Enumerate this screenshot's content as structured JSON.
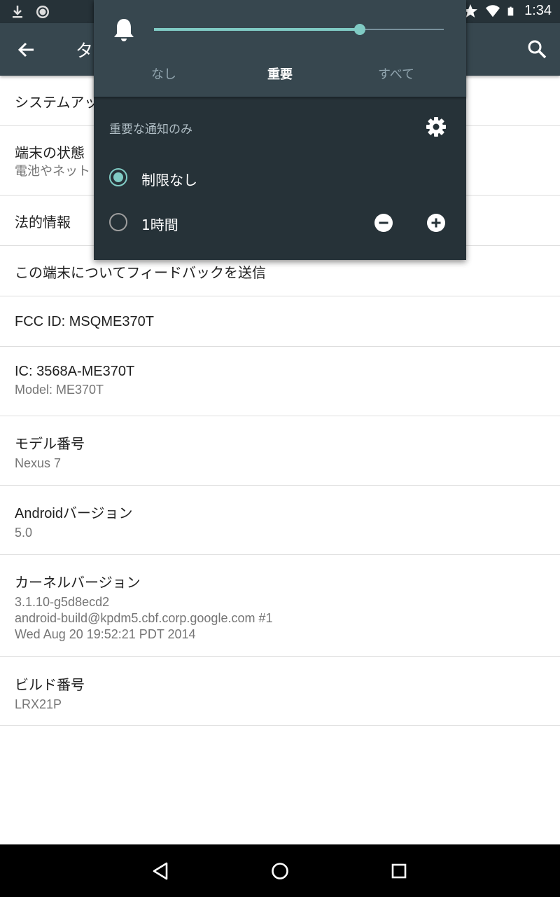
{
  "status_bar": {
    "time": "1:34",
    "left_icons": [
      "download-icon",
      "sync-icon"
    ],
    "right_icons": [
      "star-icon",
      "wifi-icon",
      "battery-icon"
    ]
  },
  "toolbar": {
    "title": "タ",
    "back_icon": "back-arrow-icon",
    "search_icon": "search-icon",
    "bg_color": "#37474f"
  },
  "list": [
    {
      "primary": "システムアッ",
      "secondary": ""
    },
    {
      "primary": "端末の状態",
      "secondary": "電池やネット"
    },
    {
      "primary": "法的情報",
      "secondary": ""
    },
    {
      "primary": "この端末についてフィードバックを送信",
      "secondary": ""
    },
    {
      "primary": "FCC ID: MSQME370T",
      "secondary": ""
    },
    {
      "primary": "IC: 3568A-ME370T",
      "secondary": "Model: ME370T"
    },
    {
      "primary": "モデル番号",
      "secondary": "Nexus 7"
    },
    {
      "primary": "Androidバージョン",
      "secondary": "5.0"
    },
    {
      "primary": "カーネルバージョン",
      "secondary": [
        "3.1.10-g5d8ecd2",
        "android-build@kpdm5.cbf.corp.google.com #1",
        "Wed Aug 20 19:52:21 PDT 2014"
      ]
    },
    {
      "primary": "ビルド番号",
      "secondary": "LRX21P"
    }
  ],
  "volume_panel": {
    "volume_level": 0.71,
    "accent_color": "#80cbc4",
    "modes": [
      "なし",
      "重要",
      "すべて"
    ],
    "active_mode": "重要",
    "header": "重要な通知のみ",
    "options": [
      {
        "label": "制限なし",
        "checked": true
      },
      {
        "label": "1時間",
        "checked": false
      }
    ],
    "icons": [
      "bell-icon",
      "gear-icon",
      "minus-circle-icon",
      "plus-circle-icon"
    ]
  },
  "nav_bar": {
    "buttons": [
      "back-triangle-icon",
      "home-circle-icon",
      "recents-square-icon"
    ]
  }
}
